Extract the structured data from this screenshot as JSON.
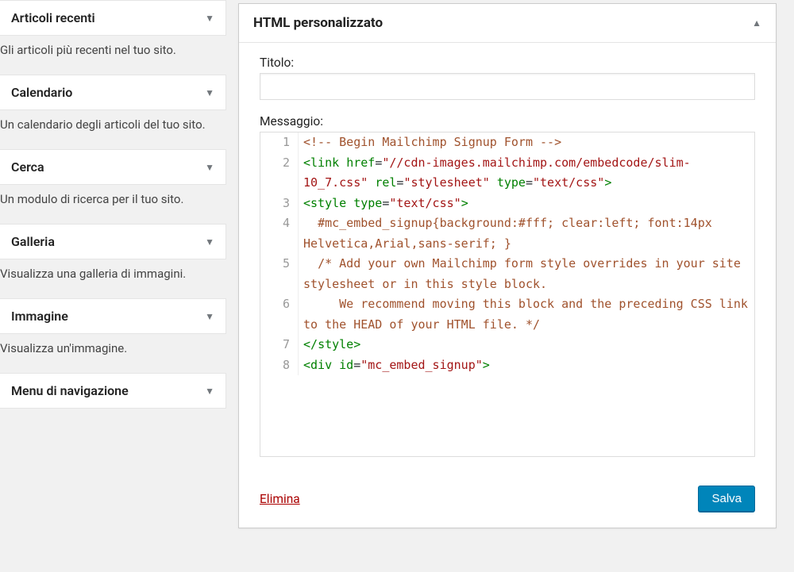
{
  "sidebar": {
    "widgets": [
      {
        "title": "Articoli recenti",
        "desc": "Gli articoli più recenti nel tuo sito."
      },
      {
        "title": "Calendario",
        "desc": "Un calendario degli articoli del tuo sito."
      },
      {
        "title": "Cerca",
        "desc": "Un modulo di ricerca per il tuo sito."
      },
      {
        "title": "Galleria",
        "desc": "Visualizza una galleria di immagini."
      },
      {
        "title": "Immagine",
        "desc": "Visualizza un'immagine."
      },
      {
        "title": "Menu di navigazione",
        "desc": ""
      }
    ]
  },
  "panel": {
    "title": "HTML personalizzato",
    "title_label": "Titolo:",
    "title_value": "",
    "message_label": "Messaggio:",
    "delete_label": "Elimina",
    "save_label": "Salva"
  },
  "code": {
    "lines": [
      {
        "n": "1",
        "html": "<span class='tok-comment'>&lt;!-- Begin Mailchimp Signup Form --&gt;</span>"
      },
      {
        "n": "2",
        "html": "<span class='tok-punct'>&lt;</span><span class='tok-tag'>link</span> <span class='tok-attr-name'>href</span>=<span class='tok-attr-val'>\"//cdn-images.mailchimp.com/embedcode/slim-10_7.css\"</span> <span class='tok-attr-name'>rel</span>=<span class='tok-attr-val'>\"stylesheet\"</span> <span class='tok-attr-name'>type</span>=<span class='tok-attr-val'>\"text/css\"</span><span class='tok-punct'>&gt;</span>"
      },
      {
        "n": "3",
        "html": "<span class='tok-punct'>&lt;</span><span class='tok-tag'>style</span> <span class='tok-attr-name'>type</span>=<span class='tok-attr-val'>\"text/css\"</span><span class='tok-punct'>&gt;</span>"
      },
      {
        "n": "4",
        "html": "&nbsp;&nbsp;<span class='tok-comment'>#mc_embed_signup{background:#fff; clear:left; font:14px Helvetica,Arial,sans-serif; }</span>"
      },
      {
        "n": "5",
        "html": "&nbsp;&nbsp;<span class='tok-comment'>/* Add your own Mailchimp form style overrides in your site stylesheet or in this style block.</span>"
      },
      {
        "n": "6",
        "html": "&nbsp;&nbsp;&nbsp;&nbsp;&nbsp;<span class='tok-comment'>We recommend moving this block and the preceding CSS link to the HEAD of your HTML file. */</span>"
      },
      {
        "n": "7",
        "html": "<span class='tok-punct'>&lt;/</span><span class='tok-tag'>style</span><span class='tok-punct'>&gt;</span>"
      },
      {
        "n": "8",
        "html": "<span class='tok-punct'>&lt;</span><span class='tok-tag'>div</span> <span class='tok-attr-name'>id</span>=<span class='tok-attr-val'>\"mc_embed_signup\"</span><span class='tok-punct'>&gt;</span>"
      }
    ]
  }
}
